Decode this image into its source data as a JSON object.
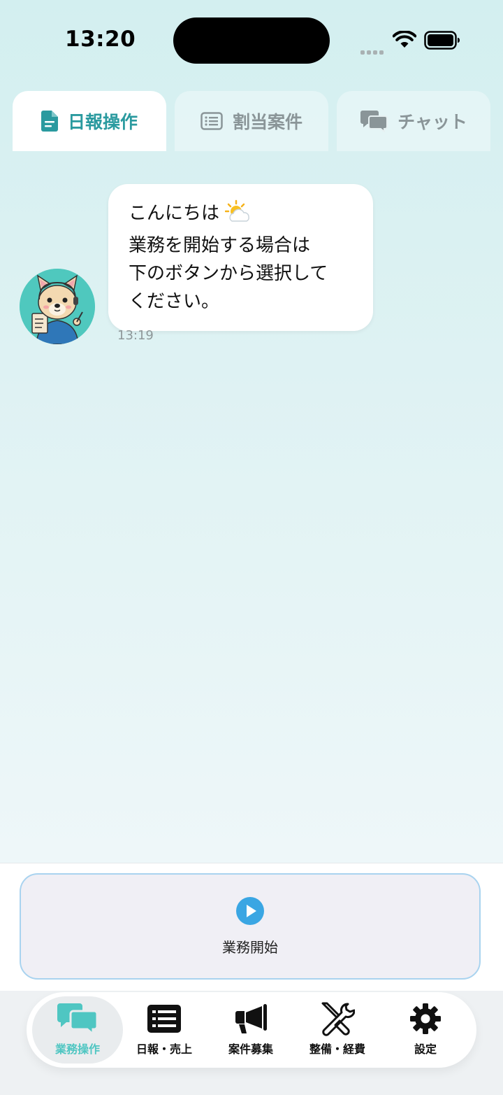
{
  "status_bar": {
    "time": "13:20"
  },
  "colors": {
    "accent": "#2a9a9f",
    "nav_active": "#4fc6c2",
    "play_button": "#3aa6e3",
    "background_top": "#d3eff0"
  },
  "top_tabs": [
    {
      "label": "日報操作",
      "icon": "document-icon",
      "active": true
    },
    {
      "label": "割当案件",
      "icon": "list-icon",
      "active": false
    },
    {
      "label": "チャット",
      "icon": "chat-bubbles-icon",
      "active": false
    }
  ],
  "chat": {
    "message": {
      "lines": [
        "こんにちは",
        "業務を開始する場合は",
        "下のボタンから選択して",
        "ください。"
      ],
      "emoji": "sun-behind-cloud-icon",
      "time": "13:19"
    }
  },
  "action": {
    "start_label": "業務開始",
    "icon": "play-icon"
  },
  "bottom_nav": [
    {
      "label": "業務操作",
      "icon": "chat-bubbles-icon",
      "active": true
    },
    {
      "label": "日報・売上",
      "icon": "list-icon",
      "active": false
    },
    {
      "label": "案件募集",
      "icon": "megaphone-icon",
      "active": false
    },
    {
      "label": "整備・経費",
      "icon": "tools-icon",
      "active": false
    },
    {
      "label": "設定",
      "icon": "gear-icon",
      "active": false
    }
  ]
}
